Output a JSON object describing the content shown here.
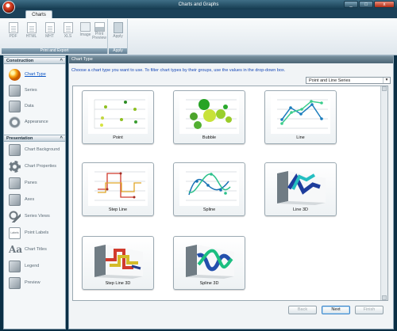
{
  "window": {
    "title": "Charts and Graphs",
    "minimize": "_",
    "maximize": "□",
    "close": "x"
  },
  "ribbon": {
    "tabs": [
      "Charts"
    ],
    "groups": [
      {
        "label": "Print and Export",
        "buttons": [
          "PDF",
          "HTML",
          "MHT",
          "XLS",
          "Image",
          "Print Preview"
        ]
      },
      {
        "label": "Apply",
        "buttons": [
          "Apply"
        ]
      }
    ]
  },
  "sidebar": {
    "sections": [
      {
        "title": "Construction",
        "items": [
          "Chart Type",
          "Series",
          "Data",
          "Appearance"
        ],
        "selected": "Chart Type"
      },
      {
        "title": "Presentation",
        "items": [
          "Chart Background",
          "Chart Properties",
          "Panes",
          "Axes",
          "Series Views",
          "Point Labels",
          "Chart Titles",
          "Legend",
          "Preview"
        ]
      }
    ],
    "collapse_symbol": "^",
    "labels_icon_text": "Labels"
  },
  "main": {
    "header": "Chart Type",
    "instruction": "Choose a chart type you want to use. To filter chart types by their groups, use the values in the drop-down box.",
    "filter_value": "Point and Line Series",
    "dropdown_arrow": "▾",
    "chart_types": [
      "Point",
      "Bubble",
      "Line",
      "Step Line",
      "Spline",
      "Line 3D",
      "Step Line 3D",
      "Spline 3D"
    ]
  },
  "wizard": {
    "back": "Back",
    "next": "Next",
    "finish": "Finish"
  }
}
